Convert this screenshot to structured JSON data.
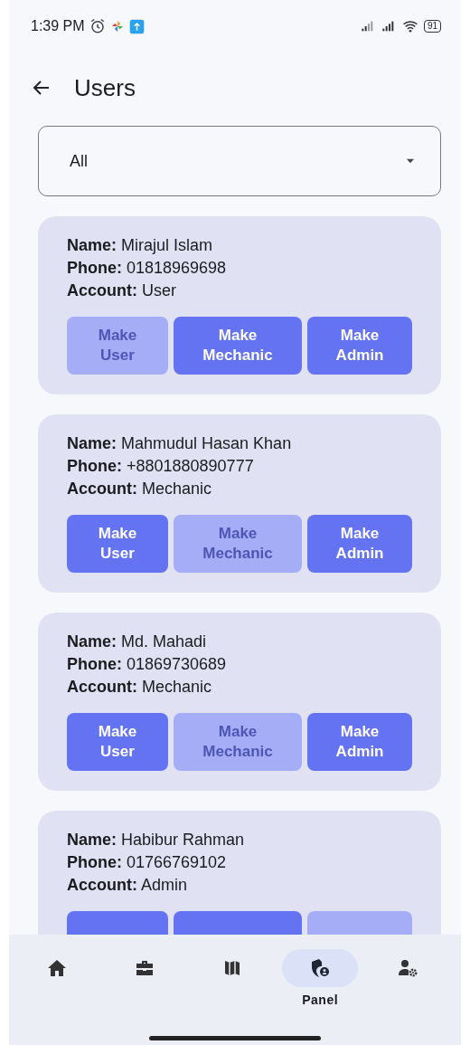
{
  "status_bar": {
    "time": "1:39 PM",
    "battery": "91"
  },
  "app_bar": {
    "title": "Users"
  },
  "filter": {
    "value": "All"
  },
  "users": [
    {
      "labels": {
        "name": "Name:",
        "phone": "Phone:",
        "account": "Account:"
      },
      "name": "Mirajul Islam",
      "phone": "01818969698",
      "account": "User",
      "buttons": [
        {
          "label": "Make\nUser",
          "disabled": true
        },
        {
          "label": "Make\nMechanic",
          "disabled": false
        },
        {
          "label": "Make\nAdmin",
          "disabled": false
        }
      ]
    },
    {
      "labels": {
        "name": "Name:",
        "phone": "Phone:",
        "account": "Account:"
      },
      "name": "Mahmudul Hasan Khan",
      "phone": "+8801880890777",
      "account": "Mechanic",
      "buttons": [
        {
          "label": "Make\nUser",
          "disabled": false
        },
        {
          "label": "Make\nMechanic",
          "disabled": true
        },
        {
          "label": "Make\nAdmin",
          "disabled": false
        }
      ]
    },
    {
      "labels": {
        "name": "Name:",
        "phone": "Phone:",
        "account": "Account:"
      },
      "name": "Md. Mahadi",
      "phone": "01869730689",
      "account": "Mechanic",
      "buttons": [
        {
          "label": "Make\nUser",
          "disabled": false
        },
        {
          "label": "Make\nMechanic",
          "disabled": true
        },
        {
          "label": "Make\nAdmin",
          "disabled": false
        }
      ]
    },
    {
      "labels": {
        "name": "Name:",
        "phone": "Phone:",
        "account": "Account:"
      },
      "name": "Habibur Rahman",
      "phone": "01766769102",
      "account": "Admin",
      "buttons": [
        {
          "disabled": false
        },
        {
          "disabled": false
        },
        {
          "disabled": true
        }
      ]
    }
  ],
  "nav": [
    {
      "kind": "home",
      "selected": false
    },
    {
      "kind": "briefcase",
      "selected": false
    },
    {
      "kind": "map",
      "selected": false
    },
    {
      "kind": "shield",
      "label": "Panel",
      "selected": true
    },
    {
      "kind": "user-gear",
      "selected": false
    }
  ]
}
